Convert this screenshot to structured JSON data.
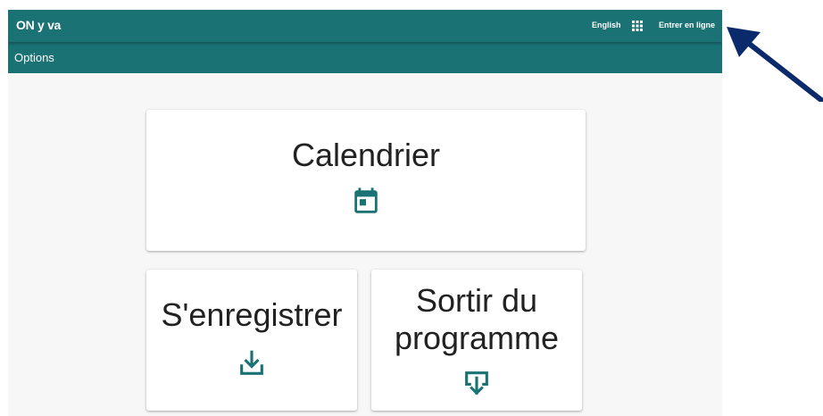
{
  "header": {
    "logo_text": "ON y va",
    "language_link": "English",
    "apps_icon": "apps-grid-icon",
    "login_link": "Entrer en ligne"
  },
  "subheader": {
    "label": "Options"
  },
  "cards": [
    {
      "title": "Calendrier",
      "icon": "calendar-today-icon"
    },
    {
      "title": "S'enregistrer",
      "icon": "download-tray-icon"
    },
    {
      "title": "Sortir du programme",
      "icon": "exit-download-icon"
    }
  ],
  "colors": {
    "primary": "#1a7275",
    "icon": "#1a7275",
    "annotation_arrow": "#0b2a6b",
    "background": "#f7f7f7"
  },
  "annotation": {
    "icon": "pointer-arrow-icon"
  }
}
